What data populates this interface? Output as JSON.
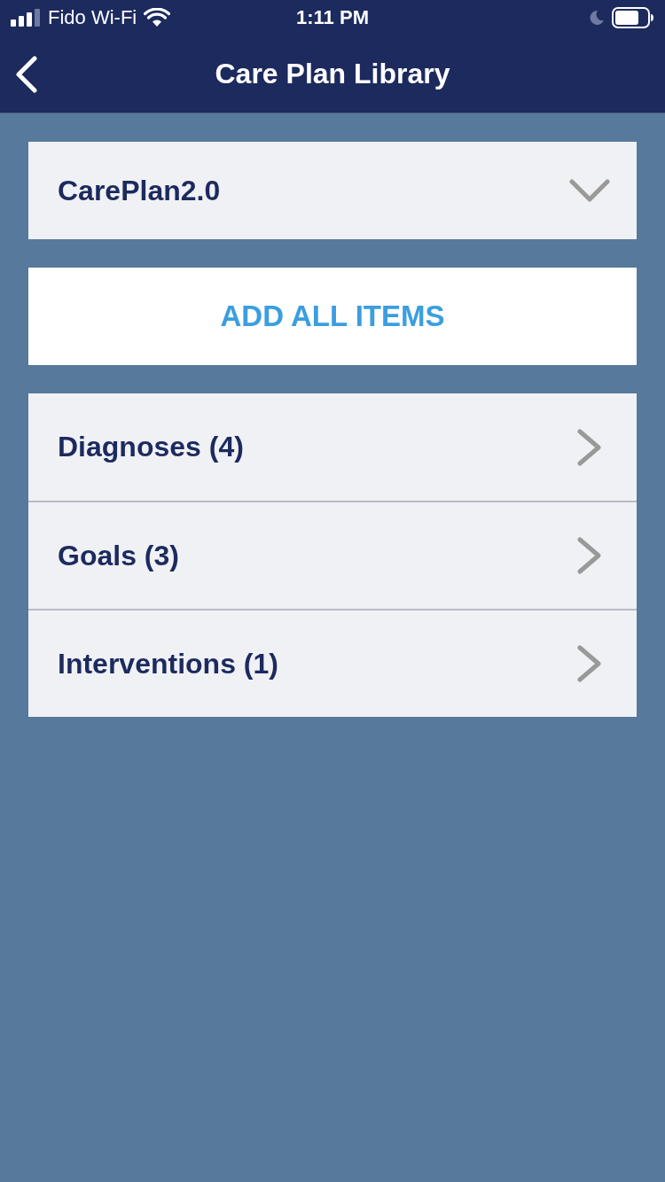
{
  "status_bar": {
    "carrier": "Fido Wi-Fi",
    "time": "1:11 PM"
  },
  "nav_bar": {
    "title": "Care Plan Library"
  },
  "plan_selector": {
    "value": "CarePlan2.0"
  },
  "add_button": {
    "label": "ADD ALL ITEMS"
  },
  "categories": [
    {
      "label": "Diagnoses (4)"
    },
    {
      "label": "Goals (3)"
    },
    {
      "label": "Interventions (1)"
    }
  ]
}
